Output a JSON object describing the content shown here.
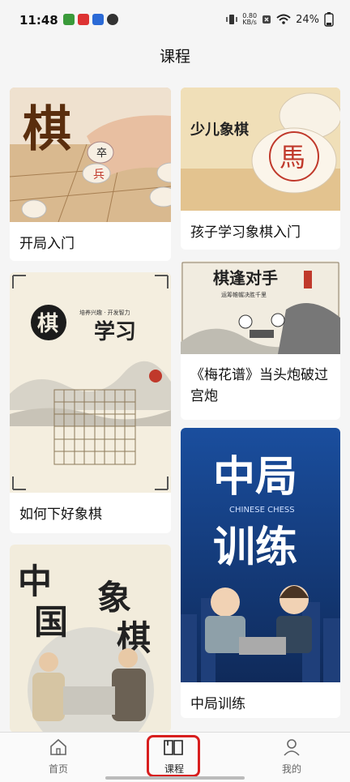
{
  "status_bar": {
    "time": "11:48",
    "speed_value": "0.80",
    "speed_unit": "KB/s",
    "battery": "24%"
  },
  "header": {
    "title": "课程"
  },
  "courses": [
    {
      "title": "开局入门",
      "image_text": "棋"
    },
    {
      "title": "孩子学习象棋入门",
      "image_text": "少儿象棋"
    },
    {
      "title": "《梅花谱》当头炮破过宫炮",
      "image_text": "棋逢对手",
      "image_subtext": "运筹帷幄决胜千里"
    },
    {
      "title": "如何下好象棋",
      "image_text_1": "棋",
      "image_text_2": "学习",
      "image_subtext": "培养兴趣 · 开发智力"
    },
    {
      "title": "中局训练",
      "image_text_1": "中局",
      "image_text_2": "训练",
      "image_subtext": "CHINESE CHESS"
    },
    {
      "title": "",
      "image_text": "中国象棋"
    }
  ],
  "bottom_nav": [
    {
      "label": "首页",
      "icon": "home-icon"
    },
    {
      "label": "课程",
      "icon": "book-icon"
    },
    {
      "label": "我的",
      "icon": "user-icon"
    }
  ],
  "colors": {
    "highlight": "#d81e1e",
    "piece_red": "#c0392b"
  }
}
